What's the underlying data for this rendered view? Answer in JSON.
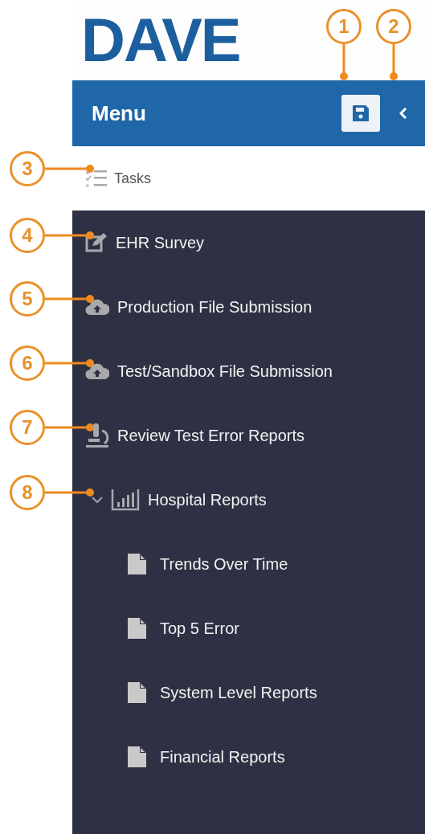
{
  "logo": "DAVE",
  "header": {
    "title": "Menu"
  },
  "tasks": {
    "label": "Tasks"
  },
  "items": [
    {
      "kind": "survey",
      "label": "EHR Survey"
    },
    {
      "kind": "upload",
      "label": "Production File Submission"
    },
    {
      "kind": "upload",
      "label": "Test/Sandbox File Submission"
    },
    {
      "kind": "review",
      "label": "Review Test Error Reports"
    },
    {
      "kind": "group",
      "label": "Hospital Reports",
      "expanded": true,
      "children": [
        {
          "label": "Trends Over Time"
        },
        {
          "label": "Top 5 Error"
        },
        {
          "label": "System Level Reports"
        },
        {
          "label": "Financial Reports"
        }
      ]
    }
  ],
  "callouts": [
    "1",
    "2",
    "3",
    "4",
    "5",
    "6",
    "7",
    "8"
  ]
}
